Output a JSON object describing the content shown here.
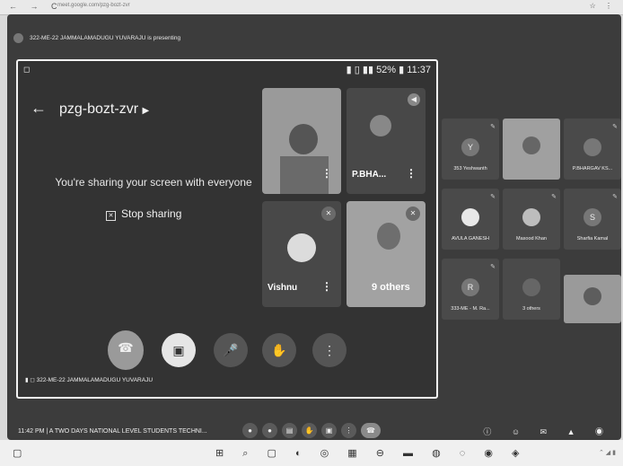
{
  "browser": {
    "url": "meet.google.com/pzg-bozt-zvr"
  },
  "banner": {
    "presenting_text": "322-ME-22 JAMMALAMADUGU YUVARAJU is presenting"
  },
  "phone": {
    "status_battery": "52%",
    "status_time": "11:37",
    "meeting_code": "pzg-bozt-zvr",
    "sharing_text": "You're sharing your screen with everyone",
    "stop_sharing": "Stop sharing",
    "tiles": [
      {
        "name": ""
      },
      {
        "name": "P.BHA..."
      },
      {
        "name": "Vishnu"
      },
      {
        "name": "9 others"
      }
    ],
    "presenter": "322-ME-22 JAMMALAMADUGU YUVARAJU"
  },
  "grid": [
    {
      "name": "353 Yeshwanth",
      "initial": "Y"
    },
    {
      "name": "",
      "initial": ""
    },
    {
      "name": "P.BHARGAV KS...",
      "initial": ""
    },
    {
      "name": "AVULA GANESH",
      "initial": ""
    },
    {
      "name": "Masood Khan",
      "initial": ""
    },
    {
      "name": "Sharfia Kamal",
      "initial": "S"
    },
    {
      "name": "333-ME - M. Ra...",
      "initial": "R"
    },
    {
      "name": "3 others",
      "initial": ""
    },
    {
      "name": "",
      "initial": ""
    }
  ],
  "bottombar": {
    "time_title": "11:42 PM  |  A TWO DAYS NATIONAL LEVEL STUDENTS TECHNI..."
  },
  "colors": {
    "end_call": "#9a9a9a",
    "background": "#3c3c3c"
  }
}
